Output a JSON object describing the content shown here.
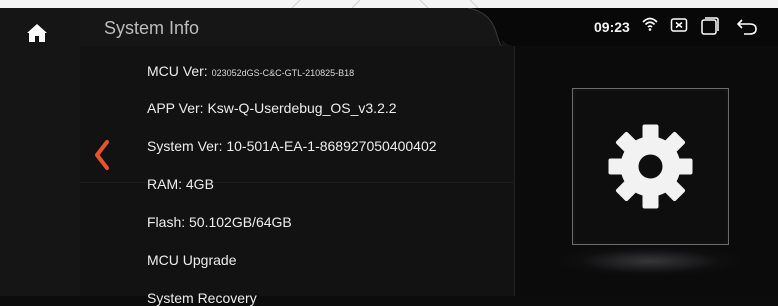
{
  "header": {
    "title": "System Info"
  },
  "status": {
    "time": "09:23"
  },
  "icons": {
    "home": "home-icon",
    "wifi": "wifi-icon",
    "close_box": "close-box-icon",
    "recent": "recent-apps-icon",
    "back": "back-return-icon",
    "nav_back": "chevron-left-icon",
    "settings": "gear-icon"
  },
  "info": {
    "mcu_label": "MCU Ver: ",
    "mcu_value": "023052dGS-C&C-GTL-210825-B18",
    "app_ver": "APP Ver: Ksw-Q-Userdebug_OS_v3.2.2",
    "system_ver": "System Ver: 10-501A-EA-1-868927050400402",
    "ram": "RAM: 4GB",
    "flash": "Flash: 50.102GB/64GB",
    "mcu_upgrade": "MCU Upgrade",
    "system_recovery": "System Recovery"
  },
  "colors": {
    "accent_arrow": "#e8542a",
    "background": "#0c0c0d"
  }
}
